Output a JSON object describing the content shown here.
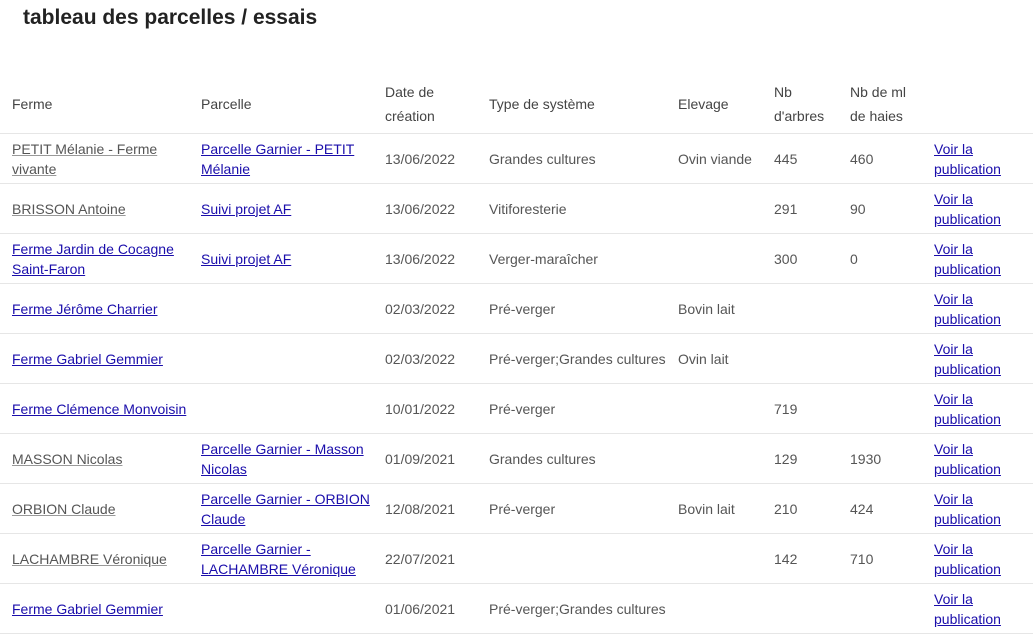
{
  "page": {
    "title": "tableau des parcelles / essais"
  },
  "table": {
    "headers": {
      "ferme": "Ferme",
      "parcelle": "Parcelle",
      "date_line1": "Date de",
      "date_line2": "création",
      "type": "Type de système",
      "elevage": "Elevage",
      "arbres_line1": "Nb",
      "arbres_line2": "d'arbres",
      "haies_line1": "Nb de ml",
      "haies_line2": "de haies"
    },
    "rows": [
      {
        "ferme": "PETIT Mélanie - Ferme vivante",
        "ferme_is_link": false,
        "parcelle": "Parcelle Garnier - PETIT Mélanie",
        "date": "13/06/2022",
        "type": "Grandes cultures",
        "elevage": "Ovin viande",
        "arbres": "445",
        "haies": "460",
        "publication": "Voir la publication"
      },
      {
        "ferme": "BRISSON Antoine",
        "ferme_is_link": false,
        "parcelle": "Suivi projet AF",
        "date": "13/06/2022",
        "type": "Vitiforesterie",
        "elevage": "",
        "arbres": "291",
        "haies": "90",
        "publication": "Voir la publication"
      },
      {
        "ferme": "Ferme Jardin de Cocagne Saint-Faron",
        "ferme_is_link": true,
        "parcelle": "Suivi projet AF",
        "date": "13/06/2022",
        "type": "Verger-maraîcher",
        "elevage": "",
        "arbres": "300",
        "haies": "0",
        "publication": "Voir la publication"
      },
      {
        "ferme": "Ferme Jérôme Charrier",
        "ferme_is_link": true,
        "parcelle": "",
        "date": "02/03/2022",
        "type": "Pré-verger",
        "elevage": "Bovin lait",
        "arbres": "",
        "haies": "",
        "publication": "Voir la publication"
      },
      {
        "ferme": "Ferme Gabriel Gemmier",
        "ferme_is_link": true,
        "parcelle": "",
        "date": "02/03/2022",
        "type": "Pré-verger;Grandes cultures",
        "elevage": "Ovin lait",
        "arbres": "",
        "haies": "",
        "publication": "Voir la publication"
      },
      {
        "ferme": "Ferme Clémence Monvoisin",
        "ferme_is_link": true,
        "parcelle": "",
        "date": "10/01/2022",
        "type": "Pré-verger",
        "elevage": "",
        "arbres": "719",
        "haies": "",
        "publication": "Voir la publication"
      },
      {
        "ferme": "MASSON Nicolas",
        "ferme_is_link": false,
        "parcelle": "Parcelle Garnier - Masson Nicolas",
        "date": "01/09/2021",
        "type": "Grandes cultures",
        "elevage": "",
        "arbres": "129",
        "haies": "1930",
        "publication": "Voir la publication"
      },
      {
        "ferme": "ORBION Claude",
        "ferme_is_link": false,
        "parcelle": "Parcelle Garnier - ORBION Claude",
        "date": "12/08/2021",
        "type": "Pré-verger",
        "elevage": "Bovin lait",
        "arbres": "210",
        "haies": "424",
        "publication": "Voir la publication"
      },
      {
        "ferme": "LACHAMBRE Véronique",
        "ferme_is_link": false,
        "parcelle": "Parcelle Garnier - LACHAMBRE Véronique",
        "date": "22/07/2021",
        "type": "",
        "elevage": "",
        "arbres": "142",
        "haies": "710",
        "publication": "Voir la publication"
      },
      {
        "ferme": "Ferme Gabriel Gemmier",
        "ferme_is_link": true,
        "parcelle": "",
        "date": "01/06/2021",
        "type": "Pré-verger;Grandes cultures",
        "elevage": "",
        "arbres": "",
        "haies": "",
        "publication": "Voir la publication"
      }
    ]
  },
  "colors": {
    "link": "#1a0dab",
    "text": "#555555",
    "title": "#222222",
    "border": "#e6e6e6"
  }
}
